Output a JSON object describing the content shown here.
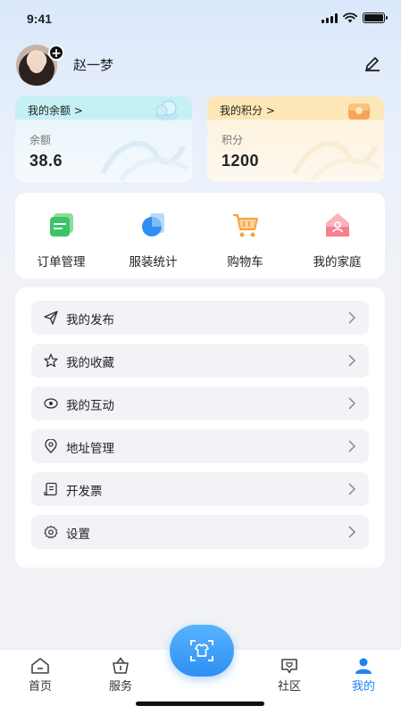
{
  "status": {
    "time": "9:41"
  },
  "profile": {
    "name": "赵一梦"
  },
  "cards": {
    "balance": {
      "header": "我的余额 >",
      "label": "余额",
      "value": "38.6"
    },
    "points": {
      "header": "我的积分 >",
      "label": "积分",
      "value": "1200"
    }
  },
  "quick_actions": [
    {
      "label": "订单管理",
      "icon": "order-icon"
    },
    {
      "label": "服装统计",
      "icon": "chart-icon"
    },
    {
      "label": "购物车",
      "icon": "cart-icon"
    },
    {
      "label": "我的家庭",
      "icon": "family-house-icon"
    }
  ],
  "menu": [
    {
      "label": "我的发布",
      "icon": "send-icon"
    },
    {
      "label": "我的收藏",
      "icon": "star-icon"
    },
    {
      "label": "我的互动",
      "icon": "eye-icon"
    },
    {
      "label": "地址管理",
      "icon": "location-icon"
    },
    {
      "label": "开发票",
      "icon": "invoice-icon"
    },
    {
      "label": "设置",
      "icon": "gear-icon"
    }
  ],
  "tabbar": {
    "home": "首页",
    "service": "服务",
    "community": "社区",
    "mine": "我的"
  },
  "colors": {
    "accent": "#1f84f0"
  }
}
